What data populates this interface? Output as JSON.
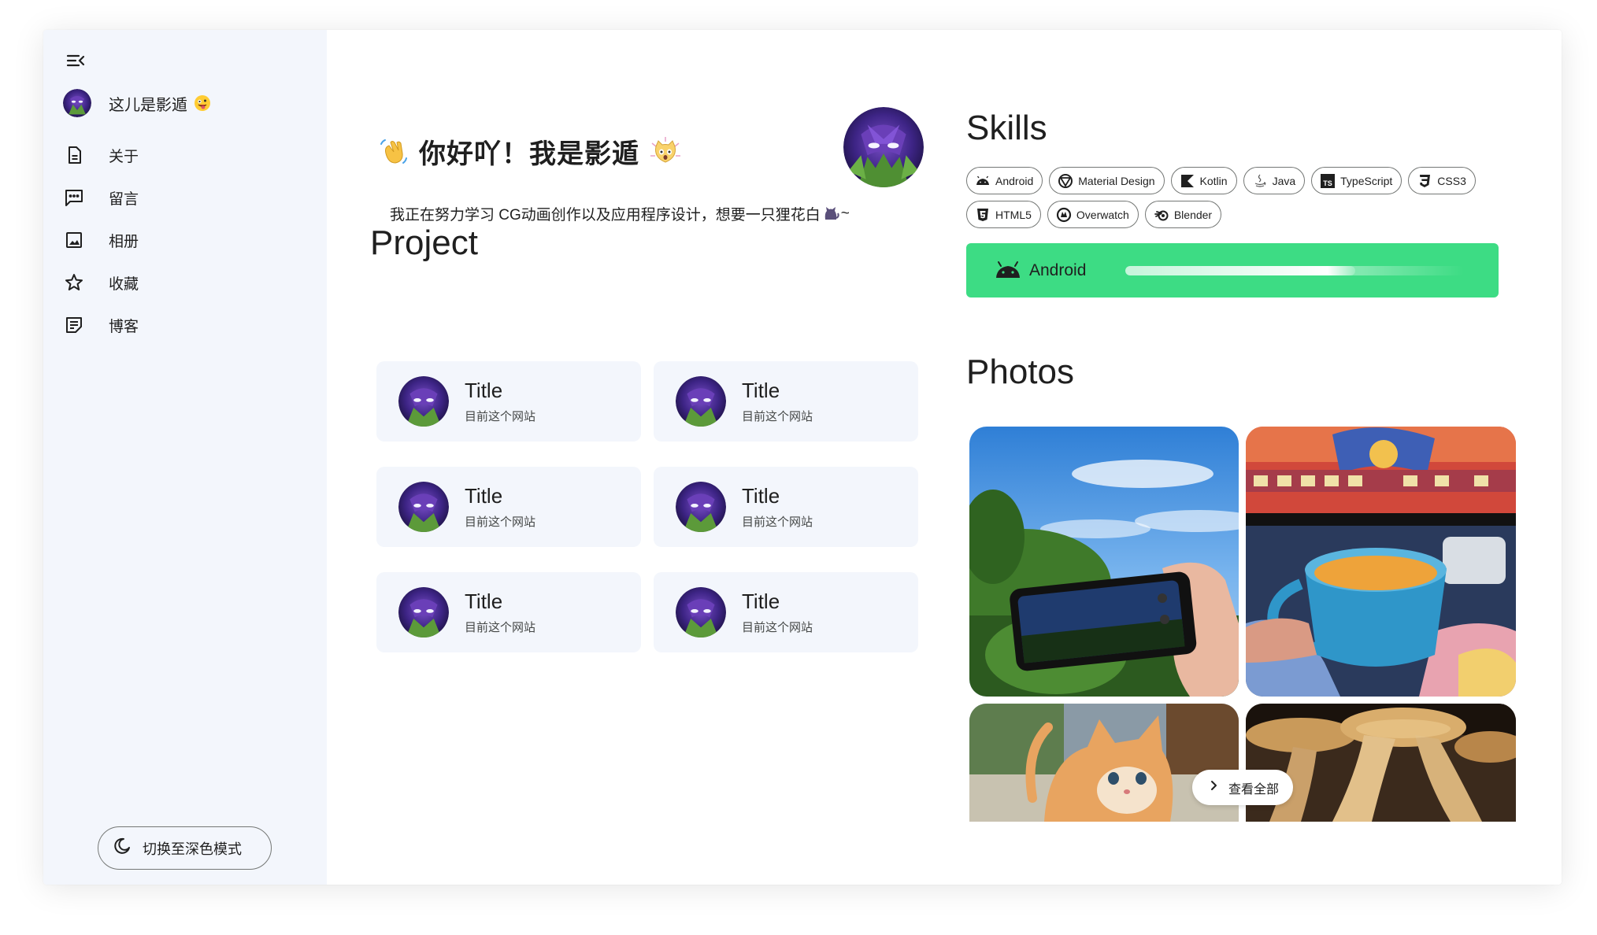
{
  "sidebar": {
    "profile_name": "这儿是影遁",
    "nav": [
      {
        "label": "关于",
        "icon": "document-icon"
      },
      {
        "label": "留言",
        "icon": "comment-icon"
      },
      {
        "label": "相册",
        "icon": "image-icon"
      },
      {
        "label": "收藏",
        "icon": "star-icon"
      },
      {
        "label": "博客",
        "icon": "article-icon"
      }
    ],
    "theme_button": "切换至深色模式"
  },
  "hero": {
    "greeting": "你好吖！我是影遁",
    "bio_prefix": "我正在努力学习 CG动画创作以及应用程序设计，想要一只狸花白",
    "bio_suffix": "~"
  },
  "project": {
    "title": "Project",
    "cards": [
      {
        "title": "Title",
        "subtitle": "目前这个网站"
      },
      {
        "title": "Title",
        "subtitle": "目前这个网站"
      },
      {
        "title": "Title",
        "subtitle": "目前这个网站"
      },
      {
        "title": "Title",
        "subtitle": "目前这个网站"
      },
      {
        "title": "Title",
        "subtitle": "目前这个网站"
      },
      {
        "title": "Title",
        "subtitle": "目前这个网站"
      }
    ]
  },
  "skills": {
    "title": "Skills",
    "chips": [
      {
        "label": "Android",
        "icon": "android-icon"
      },
      {
        "label": "Material Design",
        "icon": "material-design-icon"
      },
      {
        "label": "Kotlin",
        "icon": "kotlin-icon"
      },
      {
        "label": "Java",
        "icon": "java-icon"
      },
      {
        "label": "TypeScript",
        "icon": "typescript-icon"
      },
      {
        "label": "CSS3",
        "icon": "css3-icon"
      },
      {
        "label": "HTML5",
        "icon": "html5-icon"
      },
      {
        "label": "Overwatch",
        "icon": "overwatch-icon"
      },
      {
        "label": "Blender",
        "icon": "blender-icon"
      }
    ],
    "active": {
      "label": "Android",
      "level": 0.68,
      "color": "#3ddc84"
    }
  },
  "photos": {
    "title": "Photos",
    "view_all": "查看全部"
  }
}
